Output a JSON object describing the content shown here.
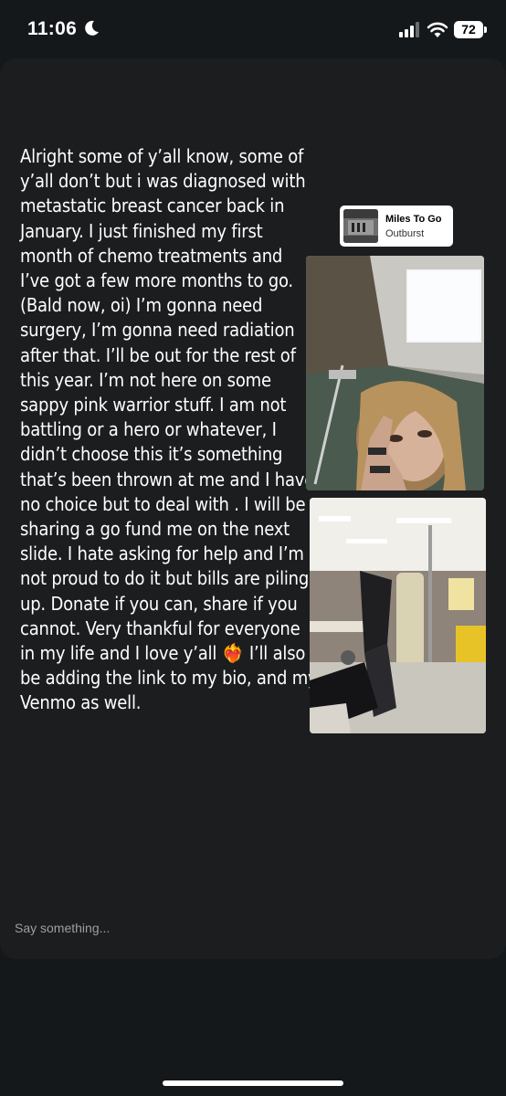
{
  "status_bar": {
    "time": "11:06",
    "battery": "72",
    "icons": [
      "moon-icon",
      "signal-icon",
      "wifi-icon",
      "battery-icon"
    ]
  },
  "story": {
    "caption": "Alright some of y’all know, some of\ny’all don’t but i was diagnosed with\nmetastatic breast cancer back in\nJanuary. I just finished my first\nmonth of chemo treatments and\nI’ve got a few more months to go.\n(Bald now, oi) I’m gonna need\nsurgery, I’m gonna need radiation\nafter that. I’ll be out for the rest of\nthis year. I’m not here on some\nsappy pink warrior stuff. I am not\nbattling or a hero or whatever, I\ndidn’t choose this it’s something\nthat’s been thrown at me and I have\nno choice but to deal with . I will be\nsharing a go fund me on the next\nslide. I hate asking for help  and I’m\nnot proud to do it but bills are piling\nup. Donate if you can, share if you\ncannot. Very thankful for everyone\nin my life and I love y’all ❤️‍🔥 I’ll also\nbe adding the link to my bio, and my\nVenmo as well.",
    "music_sticker": {
      "title": "Miles To Go",
      "artist": "Outburst"
    }
  },
  "reply": {
    "placeholder": "Say something..."
  },
  "colors": {
    "background": "#15181b",
    "card": "#1c1d1f",
    "placeholder": "#9a9ea4"
  }
}
